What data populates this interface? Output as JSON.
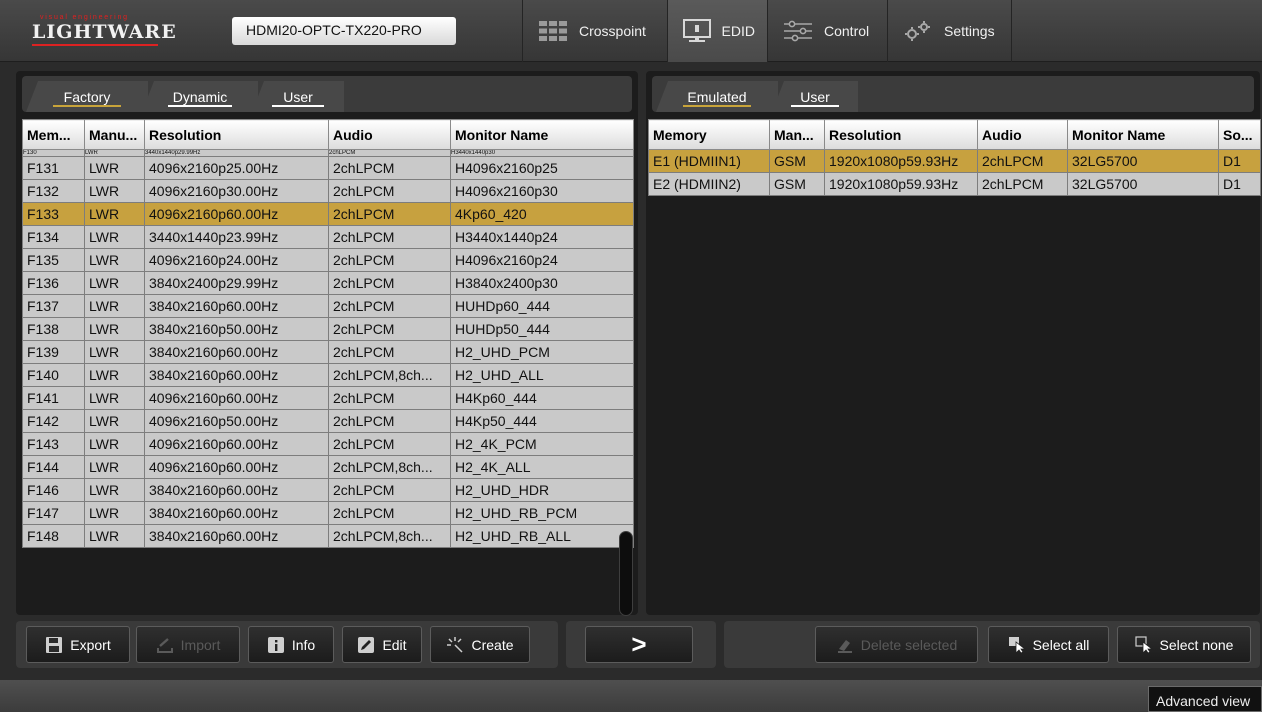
{
  "header": {
    "logo_small": "visual engineering",
    "logo_main": "LIGHTWARE",
    "device": "HDMI20-OPTC-TX220-PRO",
    "nav": [
      {
        "label": "Crosspoint",
        "icon": "grid-icon"
      },
      {
        "label": "EDID",
        "icon": "monitor-icon"
      },
      {
        "label": "Control",
        "icon": "sliders-icon"
      },
      {
        "label": "Settings",
        "icon": "gears-icon"
      }
    ],
    "active_nav": "EDID"
  },
  "left_panel": {
    "tabs": [
      "Factory",
      "Dynamic",
      "User"
    ],
    "active_tab": "Factory",
    "columns": [
      "Mem...",
      "Manu...",
      "Resolution",
      "Audio",
      "Monitor Name"
    ],
    "partial_row": [
      "F130",
      "LWR",
      "3440x1440p29.99Hz",
      "2chLPCM",
      "H3440x1440p30"
    ],
    "rows": [
      [
        "F131",
        "LWR",
        "4096x2160p25.00Hz",
        "2chLPCM",
        "H4096x2160p25"
      ],
      [
        "F132",
        "LWR",
        "4096x2160p30.00Hz",
        "2chLPCM",
        "H4096x2160p30"
      ],
      [
        "F133",
        "LWR",
        "4096x2160p60.00Hz",
        "2chLPCM",
        "4Kp60_420"
      ],
      [
        "F134",
        "LWR",
        "3440x1440p23.99Hz",
        "2chLPCM",
        "H3440x1440p24"
      ],
      [
        "F135",
        "LWR",
        "4096x2160p24.00Hz",
        "2chLPCM",
        "H4096x2160p24"
      ],
      [
        "F136",
        "LWR",
        "3840x2400p29.99Hz",
        "2chLPCM",
        "H3840x2400p30"
      ],
      [
        "F137",
        "LWR",
        "3840x2160p60.00Hz",
        "2chLPCM",
        "HUHDp60_444"
      ],
      [
        "F138",
        "LWR",
        "3840x2160p50.00Hz",
        "2chLPCM",
        "HUHDp50_444"
      ],
      [
        "F139",
        "LWR",
        "3840x2160p60.00Hz",
        "2chLPCM",
        "H2_UHD_PCM"
      ],
      [
        "F140",
        "LWR",
        "3840x2160p60.00Hz",
        "2chLPCM,8ch...",
        "H2_UHD_ALL"
      ],
      [
        "F141",
        "LWR",
        "4096x2160p60.00Hz",
        "2chLPCM",
        "H4Kp60_444"
      ],
      [
        "F142",
        "LWR",
        "4096x2160p50.00Hz",
        "2chLPCM",
        "H4Kp50_444"
      ],
      [
        "F143",
        "LWR",
        "4096x2160p60.00Hz",
        "2chLPCM",
        "H2_4K_PCM"
      ],
      [
        "F144",
        "LWR",
        "4096x2160p60.00Hz",
        "2chLPCM,8ch...",
        "H2_4K_ALL"
      ],
      [
        "F146",
        "LWR",
        "3840x2160p60.00Hz",
        "2chLPCM",
        "H2_UHD_HDR"
      ],
      [
        "F147",
        "LWR",
        "3840x2160p60.00Hz",
        "2chLPCM",
        "H2_UHD_RB_PCM"
      ],
      [
        "F148",
        "LWR",
        "3840x2160p60.00Hz",
        "2chLPCM,8ch...",
        "H2_UHD_RB_ALL"
      ]
    ],
    "selected": "F133"
  },
  "right_panel": {
    "tabs": [
      "Emulated",
      "User"
    ],
    "active_tab": "Emulated",
    "columns": [
      "Memory",
      "Man...",
      "Resolution",
      "Audio",
      "Monitor Name",
      "So..."
    ],
    "rows": [
      [
        "E1 (HDMIIN1)",
        "GSM",
        "1920x1080p59.93Hz",
        "2chLPCM",
        "32LG5700",
        "D1"
      ],
      [
        "E2 (HDMIIN2)",
        "GSM",
        "1920x1080p59.93Hz",
        "2chLPCM",
        "32LG5700",
        "D1"
      ]
    ],
    "selected": "E1 (HDMIIN1)"
  },
  "toolbar": {
    "export": "Export",
    "import": "Import",
    "info": "Info",
    "edit": "Edit",
    "create": "Create",
    "transfer": ">",
    "delete_selected": "Delete selected",
    "select_all": "Select all",
    "select_none": "Select none"
  },
  "footer": {
    "advanced_view": "Advanced view"
  },
  "colors": {
    "selection": "#c7a13f",
    "row": "#c9c9c9",
    "panel_bg": "#1c1c1c",
    "accent_underline": "#c8a43a"
  }
}
